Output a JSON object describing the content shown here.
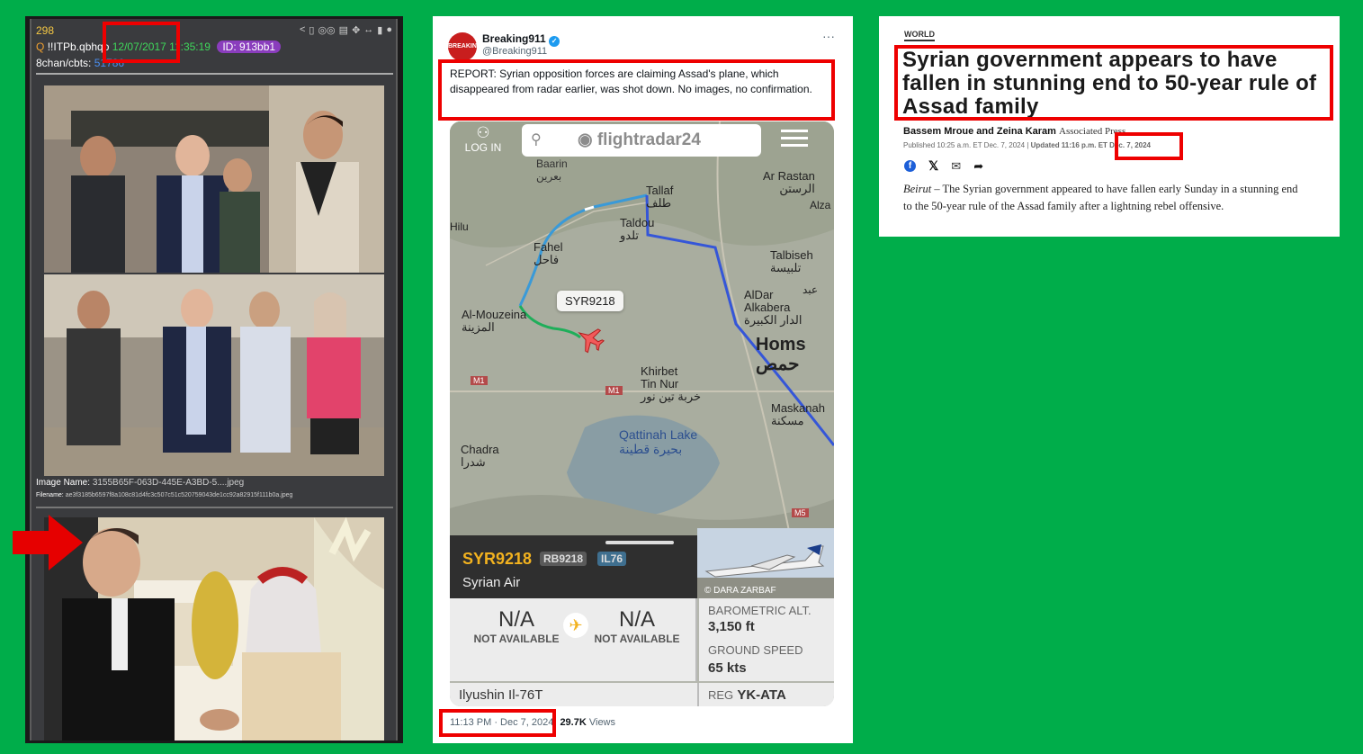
{
  "post": {
    "number": "298",
    "q_mark": "Q",
    "tripcode": "!!ITPb.qbhqo",
    "date": "12/07/2017",
    "time": "11:35:19",
    "id_label": "ID: 913bb1",
    "board": "8chan/cbts:",
    "post_ref": "51786",
    "image_name_label": "Image Name:",
    "image_name": "3155B65F-063D-445E-A3BD-5....jpeg",
    "filename_label": "Filename:",
    "filename": "ae3f3185b6597f8a108c81d4fc3c507c51c520759043de1cc92a82915f111b0a.jpeg",
    "icons": [
      "share-icon",
      "clipboard-icon",
      "glasses-icon",
      "document-icon",
      "move-icon",
      "resize-icon",
      "trash-icon",
      "bell-icon"
    ]
  },
  "tweet": {
    "avatar_text": "BREAKING 911",
    "display_name": "Breaking911",
    "handle": "@Breaking911",
    "more": "···",
    "text": "REPORT: Syrian opposition forces are claiming Assad's plane, which disappeared from radar earlier, was shot down. No images, no confirmation.",
    "timestamp": "11:13 PM · Dec 7, 2024",
    "views_count": "29.7K",
    "views_label": "Views"
  },
  "radar": {
    "login": "LOG IN",
    "brand": "flightradar24",
    "callout": "SYR9218",
    "flight": "SYR9218",
    "reg_code": "RB9218",
    "type_code": "IL76",
    "airline": "Syrian Air",
    "photo_credit": "© DARA ZARBAF",
    "origin": "N/A",
    "dest": "N/A",
    "origin_sub": "NOT AVAILABLE",
    "dest_sub": "NOT AVAILABLE",
    "baro_label": "BAROMETRIC ALT.",
    "baro_value": "3,150 ft",
    "speed_label": "GROUND SPEED",
    "speed_value": "65 kts",
    "aircraft": "Ilyushin Il-76T",
    "reg_label": "REG",
    "reg_value": "YK-ATA",
    "places": {
      "baarin": "Baarin",
      "baarin_ar": "بعرين",
      "tallaf": "Tallaf",
      "tallaf_ar": "طلف",
      "ar_rastan": "Ar Rastan",
      "ar_rastan_ar": "الرستن",
      "hilu": "Hilu",
      "alza": "Alza",
      "taldou": "Taldou",
      "taldou_ar": "تلدو",
      "fahel": "Fahel",
      "fahel_ar": "فاحل",
      "talbiseh": "Talbiseh",
      "talbiseh_ar": "تلبيسة",
      "ar_mouzeina": "Al-Mouzeina",
      "ar_mouzeina_ar": "المزينة",
      "aldar": "AlDar",
      "aldar2": "Alkabera",
      "aldar_ar": "الدار الكبيرة",
      "homs": "Homs",
      "homs_ar": "حمص",
      "khirbet": "Khirbet",
      "tin_nur": "Tin Nur",
      "khirbet_ar": "خربة تين نور",
      "qattinah": "Qattinah Lake",
      "qattinah_ar": "بحيرة قطينة",
      "maskanah": "Maskanah",
      "maskanah_ar": "مسكنة",
      "chadra": "Chadra",
      "chadra_ar": "شدرا",
      "m1": "M1",
      "m1b": "M1",
      "m5": "M5",
      "ar_jabar": "عبد"
    }
  },
  "article": {
    "section": "WORLD",
    "headline": "Syrian government appears to have fallen in stunning end to 50-year rule of Assad family",
    "authors": "Bassem Mroue and Zeina Karam",
    "agency": "Associated Press",
    "published": "Published 10:25 a.m. ET Dec. 7, 2024",
    "updated_label": "Updated 11:16 p.m. ET",
    "updated_date": "Dec. 7, 2024",
    "dateline": "Beirut",
    "body": " – The Syrian government appeared to have fallen early Sunday in a stunning end to the 50-year rule of the Assad family after a lightning rebel offensive.",
    "share_icons": [
      "facebook-icon",
      "x-icon",
      "email-icon",
      "share-arrow-icon"
    ]
  },
  "colors": {
    "background": "#00ad4a",
    "highlight": "#ee0000",
    "chan_date": "#3fd85b",
    "chan_number": "#f5c844",
    "chan_id": "#8a3dbd",
    "radar_flight": "#f2b21f",
    "path_blue": "#3556d8"
  }
}
